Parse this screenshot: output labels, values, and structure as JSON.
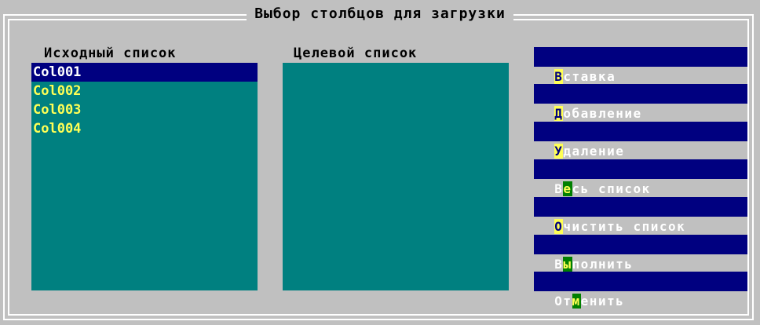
{
  "dialog": {
    "title": "Выбор столбцов для загрузки"
  },
  "source_list": {
    "label": "Исходный список",
    "items": [
      "Col001",
      "Col002",
      "Col003",
      "Col004"
    ],
    "selected_index": 0
  },
  "target_list": {
    "label": "Целевой список",
    "items": []
  },
  "buttons": [
    {
      "pre": "",
      "hotkey": "В",
      "post": "ставка"
    },
    {
      "pre": "",
      "hotkey": "Д",
      "post": "обавление"
    },
    {
      "pre": "",
      "hotkey": "У",
      "post": "даление"
    },
    {
      "pre": "В",
      "hotkey": "е",
      "post": "сь список"
    },
    {
      "pre": "",
      "hotkey": "О",
      "post": "чистить список"
    },
    {
      "pre": "В",
      "hotkey": "ы",
      "post": "полнить"
    },
    {
      "pre": "От",
      "hotkey": "м",
      "post": "енить"
    }
  ],
  "colors": {
    "background": "#c0c0c0",
    "listbox": "#008080",
    "selection": "#000080",
    "item_text": "#ffff55",
    "button": "#000080",
    "hotkey": "#ffff55"
  }
}
